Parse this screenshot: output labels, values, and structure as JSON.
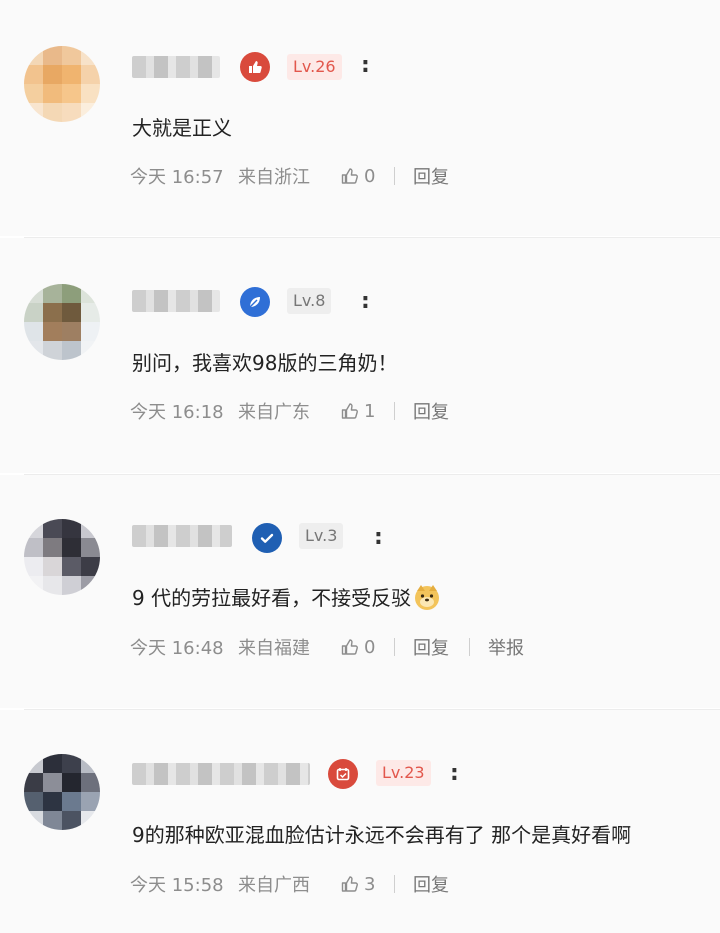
{
  "colors": {
    "level_red": "#e2574c",
    "level_gray": "#777777",
    "badge_red": "#d94a3c",
    "badge_blue": "#2f6fd6",
    "badge_navy": "#1f5fb3"
  },
  "comments": [
    {
      "level": "Lv.26",
      "text": "大就是正义",
      "time": "今天 16:57",
      "location": "来自浙江",
      "likes": "0",
      "reply": "回复",
      "badge_icon": "thumbs-up-badge-icon"
    },
    {
      "level": "Lv.8",
      "text": "别问，我喜欢98版的三角奶！",
      "time": "今天 16:18",
      "location": "来自广东",
      "likes": "1",
      "reply": "回复",
      "badge_icon": "leaf-badge-icon"
    },
    {
      "level": "Lv.3",
      "text": "9 代的劳拉最好看，不接受反驳",
      "time": "今天 16:48",
      "location": "来自福建",
      "likes": "0",
      "reply": "回复",
      "report": "举报",
      "badge_icon": "checkmark-badge-icon",
      "emoji": "doge-emoji-icon"
    },
    {
      "level": "Lv.23",
      "text": "9的那种欧亚混血脸估计永远不会再有了 那个是真好看啊",
      "time": "今天 15:58",
      "location": "来自广西",
      "likes": "3",
      "reply": "回复",
      "badge_icon": "calendar-badge-icon"
    }
  ]
}
